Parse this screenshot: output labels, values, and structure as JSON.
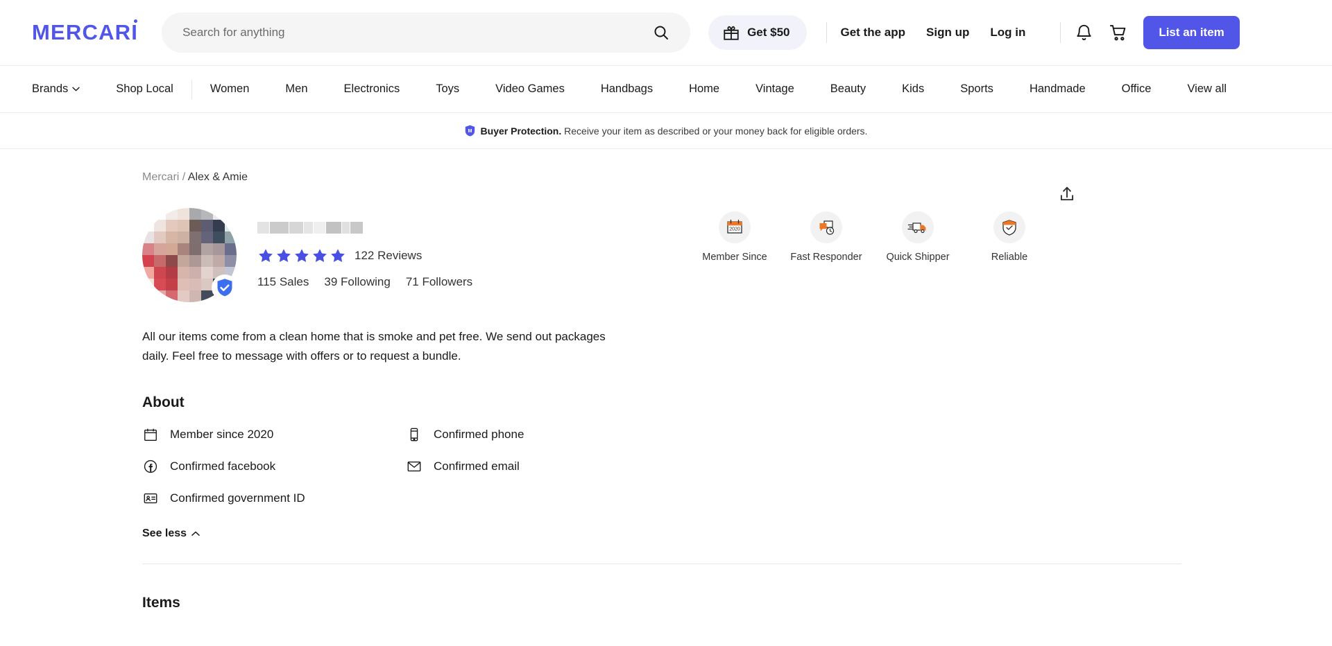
{
  "header": {
    "logo_text": "MERCARI",
    "search": {
      "placeholder": "Search for anything",
      "value": ""
    },
    "get50_label": "Get $50",
    "get_app_label": "Get the app",
    "sign_up_label": "Sign up",
    "log_in_label": "Log in",
    "list_item_label": "List an item"
  },
  "nav": {
    "brands_label": "Brands",
    "items": [
      {
        "label": "Shop Local"
      },
      {
        "label": "Women"
      },
      {
        "label": "Men"
      },
      {
        "label": "Electronics"
      },
      {
        "label": "Toys"
      },
      {
        "label": "Video Games"
      },
      {
        "label": "Handbags"
      },
      {
        "label": "Home"
      },
      {
        "label": "Vintage"
      },
      {
        "label": "Beauty"
      },
      {
        "label": "Kids"
      },
      {
        "label": "Sports"
      },
      {
        "label": "Handmade"
      },
      {
        "label": "Office"
      },
      {
        "label": "View all"
      }
    ]
  },
  "banner": {
    "bold_text": "Buyer Protection.",
    "rest_text": " Receive your item as described or your money back for eligible orders."
  },
  "breadcrumb": {
    "root": "Mercari",
    "separator": " / ",
    "current": "Alex & Amie"
  },
  "profile": {
    "name_redacted": true,
    "rating_stars": 5,
    "reviews_label": "122 Reviews",
    "sales_label": "115 Sales",
    "following_label": "39 Following",
    "followers_label": "71 Followers",
    "bio": "All our items come from a clean home that is smoke and pet free. We send out packages daily. Feel free to message with offers or to request a bundle."
  },
  "badges": [
    {
      "label": "Member Since",
      "icon": "calendar-2020-icon",
      "year": "2020"
    },
    {
      "label": "Fast Responder",
      "icon": "chat-clock-icon"
    },
    {
      "label": "Quick Shipper",
      "icon": "delivery-truck-icon"
    },
    {
      "label": "Reliable",
      "icon": "shield-check-icon"
    }
  ],
  "about": {
    "title": "About",
    "items": [
      {
        "label": "Member since 2020",
        "icon": "calendar-icon"
      },
      {
        "label": "Confirmed phone",
        "icon": "phone-icon"
      },
      {
        "label": "Confirmed facebook",
        "icon": "facebook-icon"
      },
      {
        "label": "Confirmed email",
        "icon": "envelope-icon"
      },
      {
        "label": "Confirmed government ID",
        "icon": "id-card-icon"
      }
    ],
    "see_less_label": "See less"
  },
  "items_section": {
    "title": "Items"
  },
  "colors": {
    "brand": "#5156e8",
    "star": "#4850e4",
    "badge_orange": "#ef7622",
    "verified_blue": "#3b6ff0",
    "banner_shield": "#5156e8"
  },
  "avatar_pixels": [
    "#ffffff",
    "#ffffff",
    "#f2ece9",
    "#efe3dc",
    "#a8a9ad",
    "#b6b7bb",
    "#e8eaec",
    "#ffffff",
    "#ffffff",
    "#efe4e0",
    "#e4c9bd",
    "#ddc4b5",
    "#6d5b58",
    "#5d5c72",
    "#343d50",
    "#dfe8e8",
    "#e9e2e2",
    "#e2c9c2",
    "#d8b6a6",
    "#cdb2a3",
    "#7e6f71",
    "#656379",
    "#3d4f5c",
    "#8fa2a8",
    "#d98287",
    "#d7a49b",
    "#d3a995",
    "#a9837e",
    "#7e6e6e",
    "#b0a3a2",
    "#a8979a",
    "#6a6d8c",
    "#d3424e",
    "#c66a6c",
    "#8e4a4a",
    "#c4a79b",
    "#ad9895",
    "#ccbcb8",
    "#c0aaa8",
    "#8e8ea6",
    "#f0a99f",
    "#cf4550",
    "#b33c46",
    "#d8b5aa",
    "#cdb0ab",
    "#e3d3cf",
    "#d0c0bd",
    "#c3c5d2",
    "#f5e2dc",
    "#d84a54",
    "#c34049",
    "#dfbfb5",
    "#d8bcb5",
    "#dcc8c3",
    "#2b3340",
    "#c9cbd6",
    "#faf0ec",
    "#e3a8a6",
    "#d46a70",
    "#e3cac2",
    "#cfb6b0",
    "#444c5c",
    "#1e2430",
    "#dfe2e8"
  ]
}
